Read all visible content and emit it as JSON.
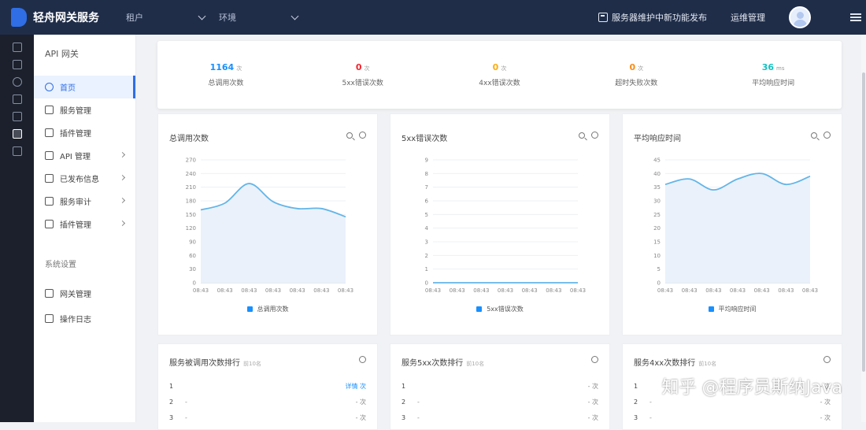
{
  "topbar": {
    "brand": "轻舟网关服务",
    "tenant_select": "租户",
    "env_select": "环境",
    "news": "服务器维护中新功能发布",
    "user_name": "运维管理"
  },
  "sidebar": {
    "title": "API 网关",
    "items": [
      {
        "label": "首页",
        "icon": "dashboard-icon",
        "active": true,
        "arrow": false
      },
      {
        "label": "服务管理",
        "icon": "service-icon",
        "active": false,
        "arrow": false
      },
      {
        "label": "插件管理",
        "icon": "plugin-icon",
        "active": false,
        "arrow": false
      },
      {
        "label": "API 管理",
        "icon": "api-icon",
        "active": false,
        "arrow": true
      },
      {
        "label": "已发布信息",
        "icon": "publish-icon",
        "active": false,
        "arrow": true
      },
      {
        "label": "服务审计",
        "icon": "audit-icon",
        "active": false,
        "arrow": true
      },
      {
        "label": "插件管理",
        "icon": "extension-icon",
        "active": false,
        "arrow": true
      }
    ],
    "group_label": "系统设置",
    "group_items": [
      {
        "label": "网关管理",
        "icon": "gateway-icon"
      },
      {
        "label": "操作日志",
        "icon": "log-icon"
      }
    ]
  },
  "stats": [
    {
      "value": "1164",
      "unit": "次",
      "label": "总调用次数",
      "color": "#1890ff"
    },
    {
      "value": "0",
      "unit": "次",
      "label": "5xx错误次数",
      "color": "#f5222d"
    },
    {
      "value": "0",
      "unit": "次",
      "label": "4xx错误次数",
      "color": "#faad14"
    },
    {
      "value": "0",
      "unit": "次",
      "label": "超时失败次数",
      "color": "#fa8c16"
    },
    {
      "value": "36",
      "unit": "ms",
      "label": "平均响应时间",
      "color": "#13c2c2"
    }
  ],
  "chart_data": [
    {
      "type": "area",
      "title": "总调用次数",
      "x": [
        "08:43",
        "08:43",
        "08:43",
        "08:43",
        "08:43",
        "08:43",
        "08:43"
      ],
      "values": [
        160,
        175,
        218,
        178,
        163,
        163,
        145
      ],
      "ylim": [
        0,
        270
      ],
      "yticks": [
        "0",
        "30",
        "60",
        "90",
        "120",
        "150",
        "180",
        "210",
        "240",
        "270"
      ],
      "legend": "总调用次数",
      "color": "#63b5e8"
    },
    {
      "type": "area",
      "title": "5xx错误次数",
      "x": [
        "08:43",
        "08:43",
        "08:43",
        "08:43",
        "08:43",
        "08:43",
        "08:43"
      ],
      "values": [
        0,
        0,
        0,
        0,
        0,
        0,
        0
      ],
      "ylim": [
        0,
        9
      ],
      "yticks": [
        "0",
        "1",
        "2",
        "3",
        "4",
        "5",
        "6",
        "7",
        "8",
        "9"
      ],
      "legend": "5xx错误次数",
      "color": "#63b5e8"
    },
    {
      "type": "area",
      "title": "平均响应时间",
      "x": [
        "08:43",
        "08:43",
        "08:43",
        "08:43",
        "08:43",
        "08:43",
        "08:43"
      ],
      "values": [
        36,
        38,
        34,
        38,
        40,
        36,
        39
      ],
      "ylim": [
        0,
        45
      ],
      "yticks": [
        "0",
        "5",
        "10",
        "15",
        "20",
        "25",
        "30",
        "35",
        "40",
        "45"
      ],
      "legend": "平均响应时间",
      "color": "#63b5e8"
    }
  ],
  "rankings": [
    {
      "title": "服务被调用次数排行",
      "sub": "前10名",
      "rows": [
        {
          "rank": "1",
          "name": "",
          "value": "详情 次",
          "link": true
        },
        {
          "rank": "2",
          "name": "-",
          "value": "- 次",
          "link": false
        },
        {
          "rank": "3",
          "name": "-",
          "value": "- 次",
          "link": false
        }
      ]
    },
    {
      "title": "服务5xx次数排行",
      "sub": "前10名",
      "rows": [
        {
          "rank": "1",
          "name": "",
          "value": "- 次",
          "link": false
        },
        {
          "rank": "2",
          "name": "-",
          "value": "- 次",
          "link": false
        },
        {
          "rank": "3",
          "name": "-",
          "value": "- 次",
          "link": false
        }
      ]
    },
    {
      "title": "服务4xx次数排行",
      "sub": "前10名",
      "rows": [
        {
          "rank": "1",
          "name": "",
          "value": "- 次",
          "link": false
        },
        {
          "rank": "2",
          "name": "-",
          "value": "- 次",
          "link": false
        },
        {
          "rank": "3",
          "name": "-",
          "value": "- 次",
          "link": false
        }
      ]
    }
  ],
  "watermark": "知乎 @程序员斯纳Java"
}
